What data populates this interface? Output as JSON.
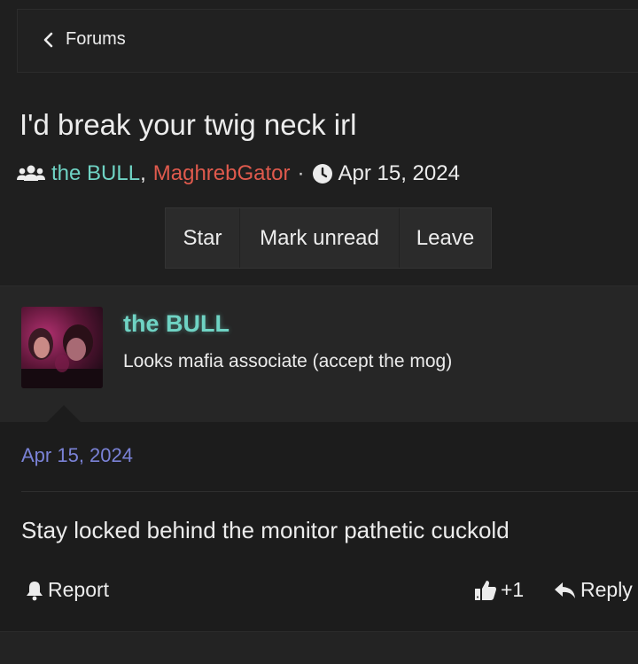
{
  "breadcrumb": {
    "label": "Forums"
  },
  "thread": {
    "title": "I'd break your twig neck irl",
    "participants": [
      {
        "name": "the BULL",
        "color": "#6fd3c4"
      },
      {
        "name": "MaghrebGator",
        "color": "#e05a4d"
      }
    ],
    "separator": ",",
    "dot": "·",
    "date": "Apr 15, 2024"
  },
  "actions": {
    "star": "Star",
    "mark_unread": "Mark unread",
    "leave": "Leave"
  },
  "first_message": {
    "author": "the BULL",
    "snippet": "Looks mafia associate (accept the mog)"
  },
  "post": {
    "date": "Apr 15, 2024",
    "body": "Stay locked behind the monitor pathetic cuckold",
    "report_label": "Report",
    "like_count": "+1",
    "reply_label": "Reply"
  },
  "icons": {
    "back": "chevron-left-icon",
    "participants": "users-icon",
    "time": "clock-icon",
    "report": "bell-icon",
    "like": "thumbs-up-icon",
    "reply": "reply-arrow-icon"
  },
  "colors": {
    "accent_date": "#7a82d6",
    "background": "#1f1f1f"
  }
}
